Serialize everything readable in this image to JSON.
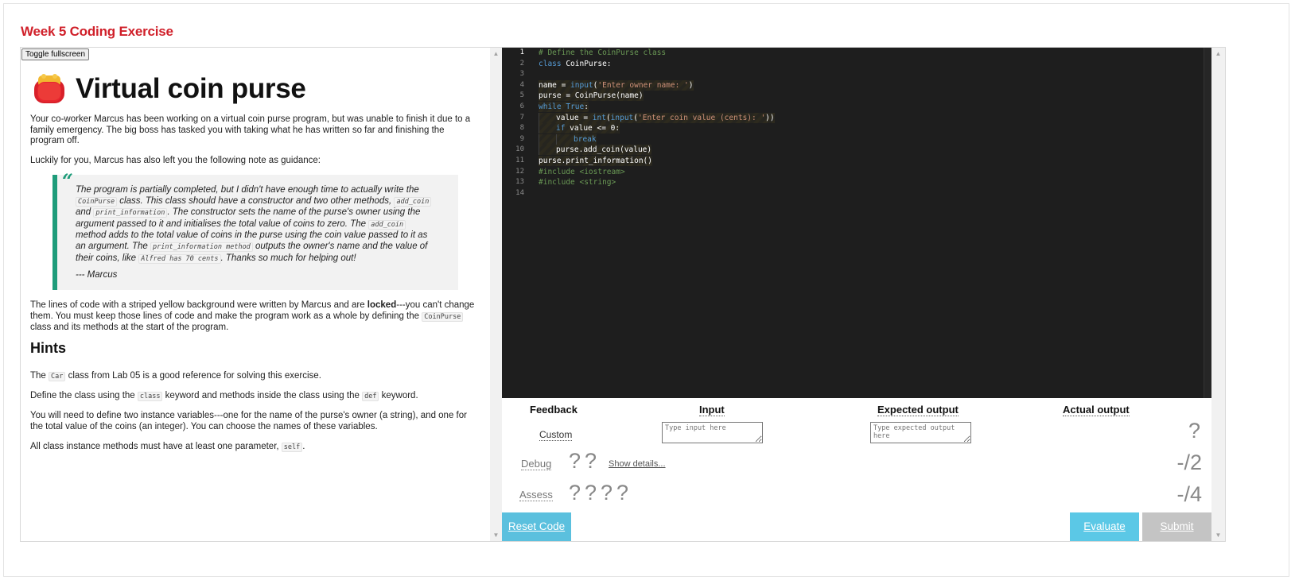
{
  "page": {
    "title": "Week 5 Coding Exercise"
  },
  "left": {
    "toggle_label": "Toggle fullscreen",
    "heading": "Virtual coin purse",
    "intro_p1": "Your co-worker Marcus has been working on a virtual coin purse program, but was unable to finish it due to a family emergency. The big boss has tasked you with taking what he has written so far and finishing the program off.",
    "intro_p2": "Luckily for you, Marcus has also left you the following note as guidance:",
    "quote": {
      "t1": "The program is partially completed, but I didn't have enough time to actually write the ",
      "c1": "CoinPurse",
      "t2": " class. This class should have a constructor and two other methods, ",
      "c2": "add_coin",
      "t3": " and ",
      "c3": "print_information",
      "t4": ". The constructor sets the name of the purse's owner using the argument passed to it and initialises the total value of coins to zero. The ",
      "c4": "add_coin",
      "t5": " method adds to the total value of coins in the purse using the coin value passed to it as an argument. The ",
      "c5": "print_information method",
      "t6": " outputs the owner's name and the value of their coins, like ",
      "c6": "Alfred has 70 cents",
      "t7": ". Thanks so much for helping out!",
      "signature": "--- Marcus"
    },
    "locked_p": {
      "t1": "The lines of code with a striped yellow background were written by Marcus and are ",
      "bold": "locked",
      "t2": "---you can't change them. You must keep those lines of code and make the program work as a whole by defining the ",
      "c1": "CoinPurse",
      "t3": " class and its methods at the start of the program."
    },
    "hints_title": "Hints",
    "hint1": {
      "t1": "The ",
      "c1": "Car",
      "t2": " class from Lab 05 is a good reference for solving this exercise."
    },
    "hint2": {
      "t1": "Define the class using the ",
      "c1": "class",
      "t2": " keyword and methods inside the class using the ",
      "c2": "def",
      "t3": " keyword."
    },
    "hint3": "You will need to define two instance variables---one for the name of the purse's owner (a string), and one for the total value of the coins (an integer). You can choose the names of these variables.",
    "hint4": {
      "t1": "All class instance methods must have at least one parameter, ",
      "c1": "self",
      "t2": "."
    }
  },
  "editor": {
    "line_numbers": [
      "1",
      "2",
      "3",
      "4",
      "5",
      "6",
      "7",
      "8",
      "9",
      "10",
      "11",
      "12",
      "13",
      "14"
    ],
    "l1": "# Define the CoinPurse class",
    "l2a": "class",
    "l2b": " CoinPurse:",
    "l4a": "name = ",
    "l4b": "input",
    "l4c": "(",
    "l4d": "'Enter owner name: '",
    "l4e": ")",
    "l5": "purse = CoinPurse(name)",
    "l6a": "while",
    "l6b": " ",
    "l6c": "True",
    "l6d": ":",
    "l7a": "value = ",
    "l7b": "int",
    "l7c": "(",
    "l7d": "input",
    "l7e": "(",
    "l7f": "'Enter coin value (cents): '",
    "l7g": "))",
    "l8a": "if",
    "l8b": " value <= 0:",
    "l9": "break",
    "l10": "purse.add_coin(value)",
    "l11": "purse.print_information()",
    "l12": "#include <iostream>",
    "l13": "#include <string>"
  },
  "panel": {
    "feedback": "Feedback",
    "input": "Input",
    "expected": "Expected output",
    "actual": "Actual output",
    "custom": "Custom",
    "input_placeholder": "Type input here",
    "expected_placeholder": "Type expected output here",
    "custom_result": "?",
    "debug": "Debug",
    "debug_marks": "??",
    "show_details": "Show details...",
    "debug_score": "-/2",
    "assess": "Assess",
    "assess_marks": "????",
    "assess_score": "-/4",
    "reset": "Reset Code",
    "evaluate": "Evaluate",
    "submit": "Submit"
  },
  "colors": {
    "title_red": "#d0202a",
    "quote_accent": "#1e9c7a",
    "button_blue": "#5bc0de",
    "submit_gray": "#c4c4c4",
    "editor_bg": "#1e1e1e"
  },
  "icons": {
    "purse": "coin-purse-icon"
  }
}
